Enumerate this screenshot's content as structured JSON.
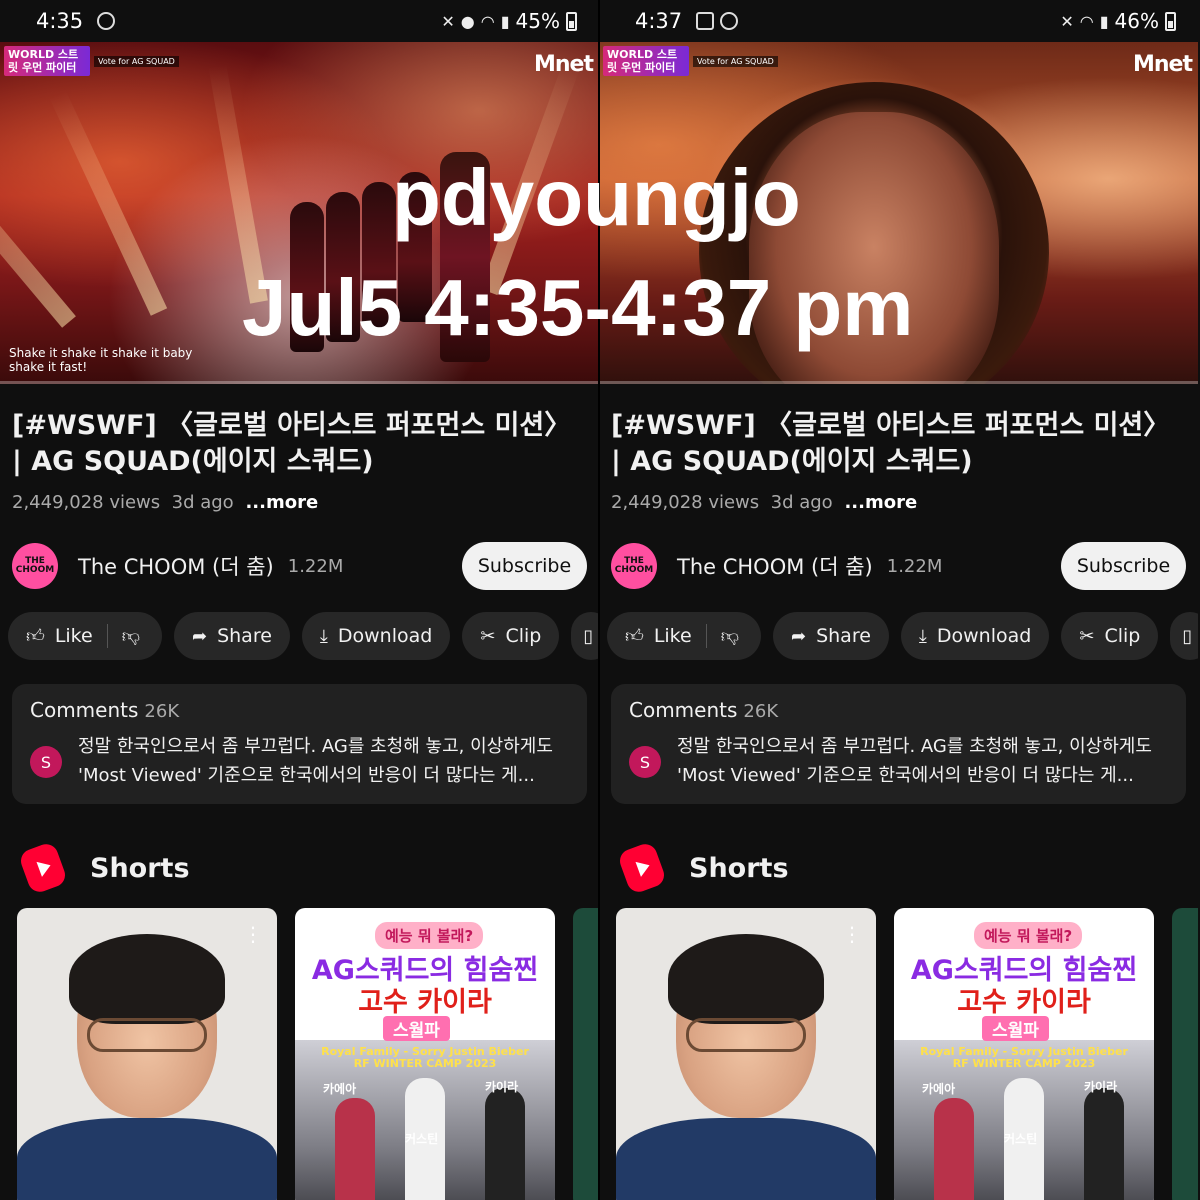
{
  "watermark": {
    "line1": "pdyoungjo",
    "line2": "Jul5 4:35-4:37 pm"
  },
  "screens": [
    {
      "status": {
        "time": "4:35",
        "battery": "45%",
        "icons": [
          "messenger-icon",
          "mute-icon",
          "location-icon",
          "wifi-icon",
          "signal-icon",
          "battery-icon"
        ]
      },
      "video": {
        "show_badge": "WORLD 스트릿 우먼 파이터",
        "vote_text": "Vote for AG SQUAD",
        "channel_logo": "Mnet",
        "caption": "Shake it shake it shake it baby shake it fast!",
        "progress": 0.0
      },
      "title": "[#WSWF] 〈글로벌 아티스트 퍼포먼스 미션〉 | AG SQUAD(에이지 스쿼드)",
      "views": "2,449,028 views",
      "age": "3d ago",
      "more": "...more",
      "channel": {
        "name": "The CHOOM (더 춤)",
        "subscribers": "1.22M",
        "avatar_text": "THE CHOOM",
        "subscribe_label": "Subscribe"
      },
      "actions": {
        "like": "Like",
        "share": "Share",
        "download": "Download",
        "clip": "Clip"
      },
      "comments": {
        "label": "Comments",
        "count": "26K",
        "avatar": "S",
        "text": "정말 한국인으로서 좀 부끄럽다. AG를 초청해 놓고, 이상하게도 'Most Viewed' 기준으로 한국에서의 반응이 더 많다는 게..."
      },
      "shorts": {
        "label": "Shorts",
        "card2": {
          "tag": "예능 뭐 볼래?",
          "line1": "AG스쿼드의 힘숨찐",
          "line2": "고수 카이라",
          "sub": "스월파",
          "song": "Royal Family - Sorry Justin Bieber",
          "camp": "RF WINTER CAMP 2023",
          "n1": "카에아",
          "n2": "카이라",
          "n3": "커스틴"
        }
      }
    },
    {
      "status": {
        "time": "4:37",
        "battery": "46%",
        "icons": [
          "gallery-icon",
          "messenger-icon",
          "mute-icon",
          "wifi-icon",
          "signal-icon",
          "battery-icon"
        ]
      },
      "video": {
        "show_badge": "WORLD 스트릿 우먼 파이터",
        "vote_text": "Vote for AG SQUAD",
        "channel_logo": "Mnet",
        "caption": "",
        "progress": 0.0
      },
      "title": "[#WSWF] 〈글로벌 아티스트 퍼포먼스 미션〉 | AG SQUAD(에이지 스쿼드)",
      "views": "2,449,028 views",
      "age": "3d ago",
      "more": "...more",
      "channel": {
        "name": "The CHOOM (더 춤)",
        "subscribers": "1.22M",
        "avatar_text": "THE CHOOM",
        "subscribe_label": "Subscribe"
      },
      "actions": {
        "like": "Like",
        "share": "Share",
        "download": "Download",
        "clip": "Clip"
      },
      "comments": {
        "label": "Comments",
        "count": "26K",
        "avatar": "S",
        "text": "정말 한국인으로서 좀 부끄럽다. AG를 초청해 놓고, 이상하게도 'Most Viewed' 기준으로 한국에서의 반응이 더 많다는 게..."
      },
      "shorts": {
        "label": "Shorts",
        "card2": {
          "tag": "예능 뭐 볼래?",
          "line1": "AG스쿼드의 힘숨찐",
          "line2": "고수 카이라",
          "sub": "스월파",
          "song": "Royal Family - Sorry Justin Bieber",
          "camp": "RF WINTER CAMP 2023",
          "n1": "카에아",
          "n2": "카이라",
          "n3": "커스틴"
        }
      }
    }
  ]
}
